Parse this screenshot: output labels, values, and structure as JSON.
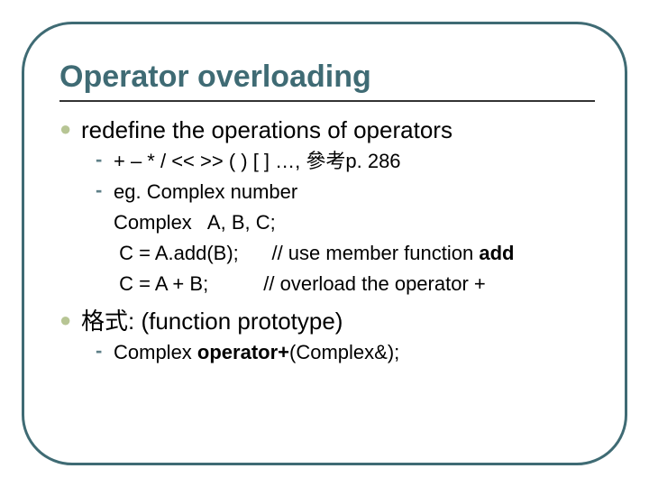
{
  "title": "Operator overloading",
  "bullets": {
    "b1": "redefine the operations of operators",
    "b1a": "+   –   *   /   <<   >>  ( )   [ ]  …,  參考p. 286",
    "b1b": "eg.  Complex number",
    "b1c": "Complex   A, B, C;",
    "b1d_pre": " C = A.add(B);      // use member function ",
    "b1d_bold": "add",
    "b1e": " C = A + B;          // overload the operator +",
    "b2": "格式: (function prototype)",
    "b2a_pre": "Complex  ",
    "b2a_bold": "operator+",
    "b2a_post": "(Complex&);"
  }
}
